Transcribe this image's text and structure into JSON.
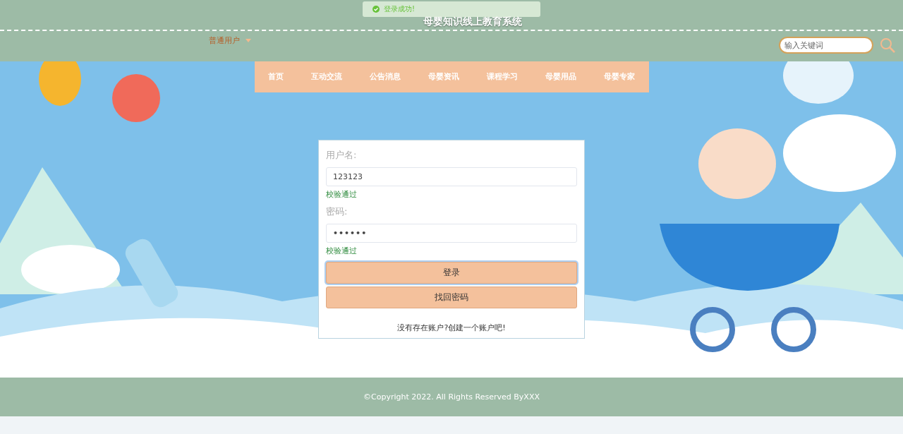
{
  "header": {
    "title": "母婴知识线上教育系统",
    "user_menu": "普通用户",
    "search": {
      "placeholder": "输入关键词"
    }
  },
  "toast": {
    "kind": "success",
    "text": "登录成功!"
  },
  "nav": [
    {
      "label": "首页",
      "selected": false
    },
    {
      "label": "互动交流",
      "selected": false
    },
    {
      "label": "公告消息",
      "selected": false
    },
    {
      "label": "母婴资讯",
      "selected": false
    },
    {
      "label": "课程学习",
      "selected": false
    },
    {
      "label": "母婴用品",
      "selected": false
    },
    {
      "label": "母婴专家",
      "selected": false
    }
  ],
  "login": {
    "fields": [
      {
        "label": "用户名:",
        "value": "123123",
        "kind": "text",
        "hint": "校验通过"
      },
      {
        "label": "密码:",
        "value": "••••••",
        "kind": "password",
        "hint": "校验通过"
      }
    ],
    "buttons": [
      {
        "label": "登录",
        "focused": true
      },
      {
        "label": "找回密码",
        "focused": false
      }
    ],
    "register_link": "没有存在账户?创建一个账户吧!"
  },
  "footer": {
    "copyright": "©Copyright 2022. All Rights Reserved ByXXX"
  }
}
